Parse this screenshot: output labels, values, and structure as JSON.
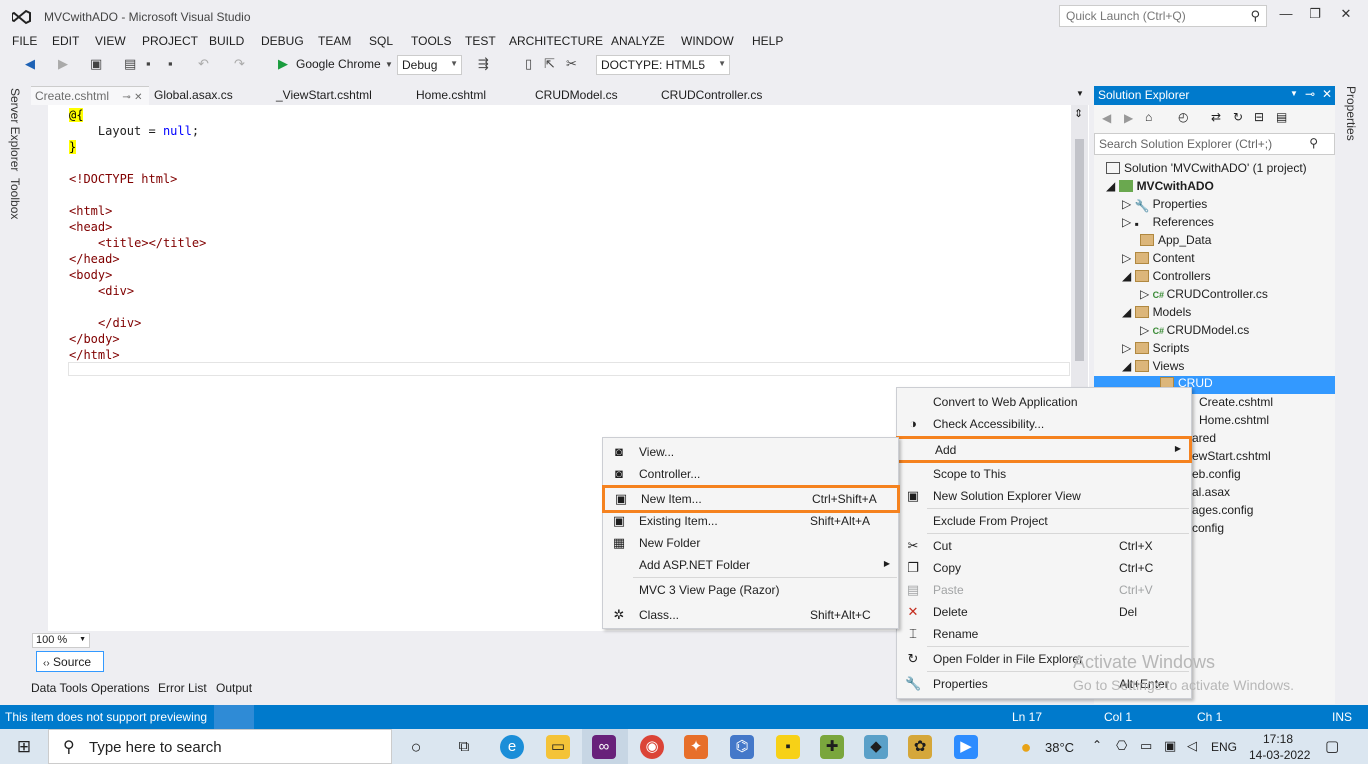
{
  "window": {
    "title": "MVCwithADO - Microsoft Visual Studio",
    "quick_launch": "Quick Launch (Ctrl+Q)"
  },
  "menu": [
    "FILE",
    "EDIT",
    "VIEW",
    "PROJECT",
    "BUILD",
    "DEBUG",
    "TEAM",
    "SQL",
    "TOOLS",
    "TEST",
    "ARCHITECTURE",
    "ANALYZE",
    "WINDOW",
    "HELP"
  ],
  "toolbar": {
    "run_target": "Google Chrome",
    "config": "Debug",
    "doctype": "DOCTYPE: HTML5"
  },
  "left_strip": {
    "server_explorer": "Server Explorer",
    "toolbox": "Toolbox"
  },
  "tabs": [
    "Create.cshtml",
    "Global.asax.cs",
    "_ViewStart.cshtml",
    "Home.cshtml",
    "CRUDModel.cs",
    "CRUDController.cs"
  ],
  "code": {
    "l1": "@{",
    "l2_a": "Layout",
    "l2_b": " = ",
    "l2_c": "null",
    "l2_d": ";",
    "l3": "}",
    "l5": "<!DOCTYPE html>",
    "l7": "<html>",
    "l8": "<head>",
    "l9": "<title></title>",
    "l10": "</head>",
    "l11": "<body>",
    "l12": "<div>",
    "l14": "</div>",
    "l15": "</body>",
    "l16": "</html>"
  },
  "zoom": "100 %",
  "source_button": "Source",
  "bottom_tabs": [
    "Data Tools Operations",
    "Error List",
    "Output"
  ],
  "status": {
    "message": "This item does not support previewing",
    "ln": "Ln 17",
    "col": "Col 1",
    "ch": "Ch 1",
    "mode": "INS"
  },
  "solution_explorer": {
    "title": "Solution Explorer",
    "search": "Search Solution Explorer (Ctrl+;)",
    "solution": "Solution 'MVCwithADO' (1 project)",
    "project": "MVCwithADO",
    "nodes": [
      "Properties",
      "References",
      "App_Data",
      "Content",
      "Controllers",
      "CRUDController.cs",
      "Models",
      "CRUDModel.cs",
      "Scripts",
      "Views",
      "CRUD",
      "Create.cshtml",
      "Home.cshtml",
      "ared",
      "ewStart.cshtml",
      "eb.config",
      "al.asax",
      "ages.config",
      "config"
    ],
    "properties_tab": "Properties"
  },
  "context_menu": {
    "items": [
      {
        "label": "Convert to Web Application",
        "shortcut": ""
      },
      {
        "label": "Check Accessibility...",
        "shortcut": ""
      },
      {
        "label": "Add",
        "shortcut": ""
      },
      {
        "label": "Scope to This",
        "shortcut": ""
      },
      {
        "label": "New Solution Explorer View",
        "shortcut": ""
      },
      {
        "label": "Exclude From Project",
        "shortcut": ""
      },
      {
        "label": "Cut",
        "shortcut": "Ctrl+X"
      },
      {
        "label": "Copy",
        "shortcut": "Ctrl+C"
      },
      {
        "label": "Paste",
        "shortcut": "Ctrl+V"
      },
      {
        "label": "Delete",
        "shortcut": "Del"
      },
      {
        "label": "Rename",
        "shortcut": ""
      },
      {
        "label": "Open Folder in File Explorer",
        "shortcut": ""
      },
      {
        "label": "Properties",
        "shortcut": "Alt+Enter"
      }
    ]
  },
  "add_submenu": {
    "items": [
      {
        "label": "View...",
        "shortcut": ""
      },
      {
        "label": "Controller...",
        "shortcut": ""
      },
      {
        "label": "New Item...",
        "shortcut": "Ctrl+Shift+A"
      },
      {
        "label": "Existing Item...",
        "shortcut": "Shift+Alt+A"
      },
      {
        "label": "New Folder",
        "shortcut": ""
      },
      {
        "label": "Add ASP.NET Folder",
        "shortcut": ""
      },
      {
        "label": "MVC 3 View Page (Razor)",
        "shortcut": ""
      },
      {
        "label": "Class...",
        "shortcut": "Shift+Alt+C"
      }
    ]
  },
  "watermark": {
    "line1": "Activate Windows",
    "line2": "Go to Settings to activate Windows."
  },
  "taskbar": {
    "search": "Type here to search",
    "weather": "38°C",
    "lang": "ENG",
    "time": "17:18",
    "date": "14-03-2022"
  }
}
